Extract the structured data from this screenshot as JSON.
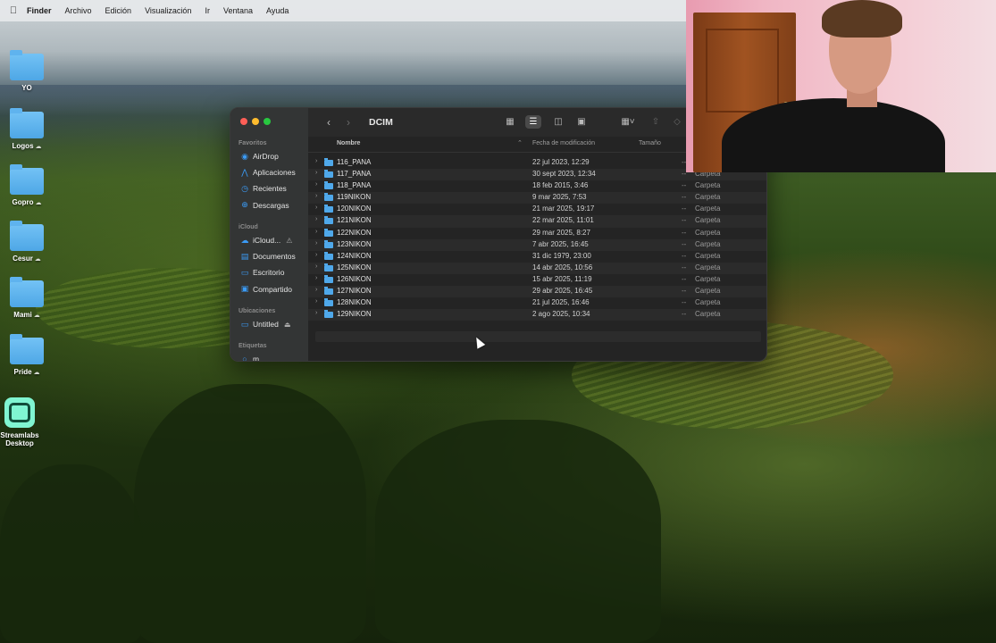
{
  "menubar": {
    "apple_icon": "apple-logo-icon",
    "items": [
      {
        "label": "Finder",
        "bold": true
      },
      {
        "label": "Archivo"
      },
      {
        "label": "Edición"
      },
      {
        "label": "Visualización"
      },
      {
        "label": "Ir"
      },
      {
        "label": "Ventana"
      },
      {
        "label": "Ayuda"
      }
    ]
  },
  "desktop": {
    "icons": [
      {
        "label": "YO",
        "type": "folder",
        "cloud": false
      },
      {
        "label": "Logos",
        "type": "folder",
        "cloud": true
      },
      {
        "label": "Gopro",
        "type": "folder",
        "cloud": true
      },
      {
        "label": "Cesur",
        "type": "folder",
        "cloud": true
      },
      {
        "label": "Mami",
        "type": "folder",
        "cloud": true
      },
      {
        "label": "Pride",
        "type": "folder",
        "cloud": true
      },
      {
        "label": "Streamlabs Desktop",
        "type": "app",
        "cloud": false
      }
    ]
  },
  "finder": {
    "title": "DCIM",
    "sidebar": {
      "favoritos_title": "Favoritos",
      "favoritos": [
        {
          "label": "AirDrop",
          "icon": "airdrop-icon",
          "glyph": "◉"
        },
        {
          "label": "Aplicaciones",
          "icon": "applications-icon",
          "glyph": "⋀"
        },
        {
          "label": "Recientes",
          "icon": "recents-clock-icon",
          "glyph": "◷"
        },
        {
          "label": "Descargas",
          "icon": "downloads-icon",
          "glyph": "⊕"
        }
      ],
      "icloud_title": "iCloud",
      "icloud": [
        {
          "label": "iCloud...",
          "icon": "icloud-icon",
          "glyph": "☁",
          "trail": "⚠"
        },
        {
          "label": "Documentos",
          "icon": "documents-icon",
          "glyph": "▤"
        },
        {
          "label": "Escritorio",
          "icon": "desktop-icon",
          "glyph": "▭"
        },
        {
          "label": "Compartido",
          "icon": "shared-folder-icon",
          "glyph": "▣"
        }
      ],
      "ubicaciones_title": "Ubicaciones",
      "ubicaciones": [
        {
          "label": "Untitled",
          "icon": "drive-icon",
          "glyph": "▭",
          "trail": "⏏"
        }
      ],
      "etiquetas_title": "Etiquetas",
      "etiquetas": [
        {
          "label": "m",
          "icon": "tag-icon",
          "glyph": "○"
        }
      ]
    },
    "columns": {
      "name": "Nombre",
      "date": "Fecha de modificación",
      "size": "Tamaño"
    },
    "rows": [
      {
        "name": "116_PANA",
        "date": "22 jul 2023, 12:29",
        "size": "--",
        "kind": "Carpeta"
      },
      {
        "name": "117_PANA",
        "date": "30 sept 2023, 12:34",
        "size": "--",
        "kind": "Carpeta"
      },
      {
        "name": "118_PANA",
        "date": "18 feb 2015, 3:46",
        "size": "--",
        "kind": "Carpeta"
      },
      {
        "name": "119NIKON",
        "date": "9 mar 2025, 7:53",
        "size": "--",
        "kind": "Carpeta"
      },
      {
        "name": "120NIKON",
        "date": "21 mar 2025, 19:17",
        "size": "--",
        "kind": "Carpeta"
      },
      {
        "name": "121NIKON",
        "date": "22 mar 2025, 11:01",
        "size": "--",
        "kind": "Carpeta"
      },
      {
        "name": "122NIKON",
        "date": "29 mar 2025, 8:27",
        "size": "--",
        "kind": "Carpeta"
      },
      {
        "name": "123NIKON",
        "date": "7 abr 2025, 16:45",
        "size": "--",
        "kind": "Carpeta"
      },
      {
        "name": "124NIKON",
        "date": "31 dic 1979, 23:00",
        "size": "--",
        "kind": "Carpeta"
      },
      {
        "name": "125NIKON",
        "date": "14 abr 2025, 10:56",
        "size": "--",
        "kind": "Carpeta"
      },
      {
        "name": "126NIKON",
        "date": "15 abr 2025, 11:19",
        "size": "--",
        "kind": "Carpeta"
      },
      {
        "name": "127NIKON",
        "date": "29 abr 2025, 16:45",
        "size": "--",
        "kind": "Carpeta"
      },
      {
        "name": "128NIKON",
        "date": "21 jul 2025, 16:46",
        "size": "--",
        "kind": "Carpeta"
      },
      {
        "name": "129NIKON",
        "date": "2 ago 2025, 10:34",
        "size": "--",
        "kind": "Carpeta"
      }
    ]
  },
  "colors": {
    "window_bg": "#242424",
    "sidebar_bg": "#343636",
    "folder_blue": "#4fa8ea",
    "accent": "#3b9bf5",
    "traffic_red": "#fe5f57",
    "traffic_yellow": "#febc2e",
    "traffic_green": "#28c840"
  }
}
